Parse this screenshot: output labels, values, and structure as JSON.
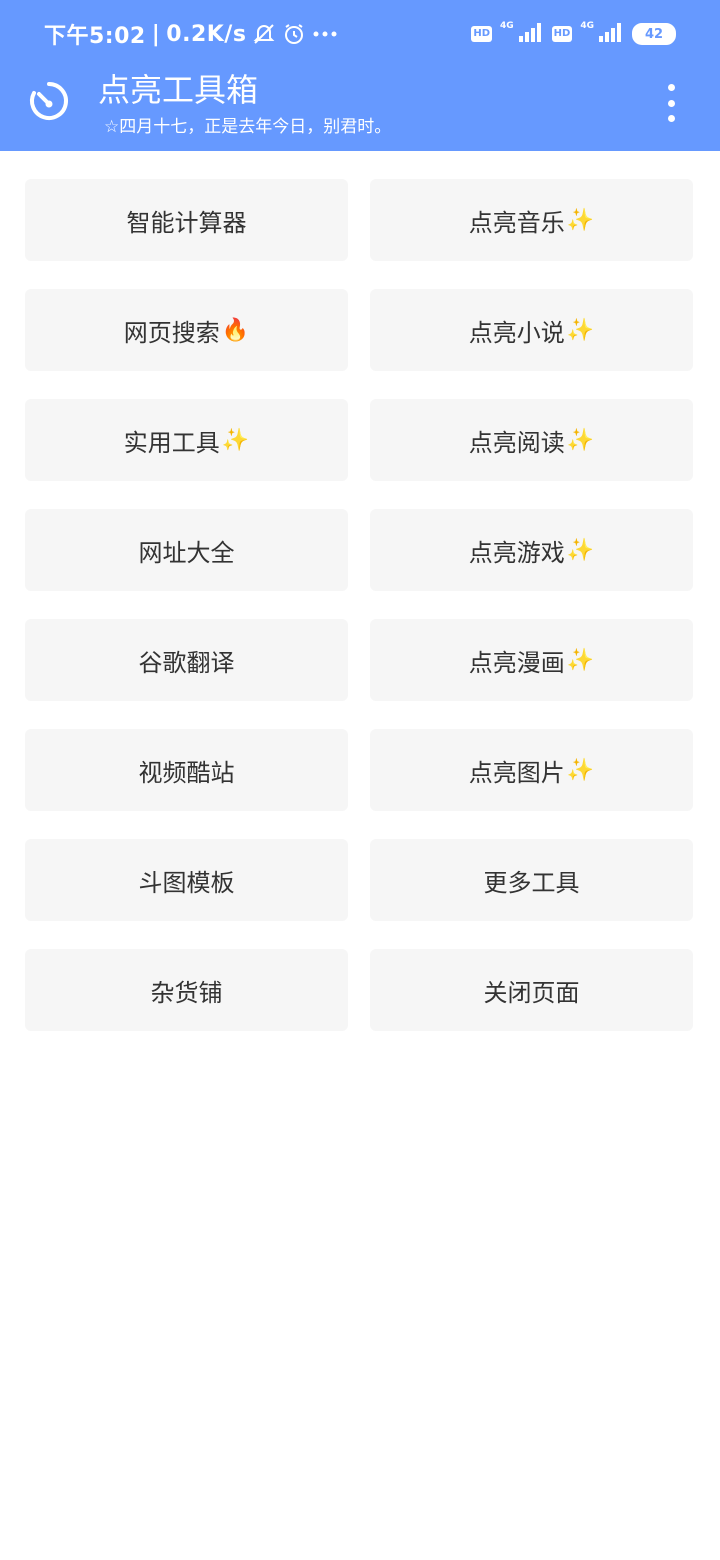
{
  "status_bar": {
    "time": "下午5:02",
    "separator": "|",
    "net_speed": "0.2K/s",
    "icons": [
      "mute-icon",
      "alarm-icon",
      "more-dots-icon"
    ],
    "sim1": {
      "hd": "HD",
      "net": "4G"
    },
    "sim2": {
      "hd": "HD",
      "net": "4G"
    },
    "battery": "42"
  },
  "app_bar": {
    "title": "点亮工具箱",
    "subtitle": "☆四月十七，正是去年今日，别君时。",
    "left_icon": "timer-icon",
    "right_icon": "more-vert-icon"
  },
  "colors": {
    "header": "#6699ff",
    "tile_bg": "#f6f6f6",
    "tile_text": "#333333"
  },
  "tiles": [
    {
      "label": "智能计算器",
      "emoji": ""
    },
    {
      "label": "点亮音乐",
      "emoji": "✨"
    },
    {
      "label": "网页搜索",
      "emoji": "🔥"
    },
    {
      "label": "点亮小说",
      "emoji": "✨"
    },
    {
      "label": "实用工具",
      "emoji": "✨"
    },
    {
      "label": "点亮阅读",
      "emoji": "✨"
    },
    {
      "label": "网址大全",
      "emoji": ""
    },
    {
      "label": "点亮游戏",
      "emoji": "✨"
    },
    {
      "label": "谷歌翻译",
      "emoji": ""
    },
    {
      "label": "点亮漫画",
      "emoji": "✨"
    },
    {
      "label": "视频酷站",
      "emoji": ""
    },
    {
      "label": "点亮图片",
      "emoji": "✨"
    },
    {
      "label": "斗图模板",
      "emoji": ""
    },
    {
      "label": "更多工具",
      "emoji": ""
    },
    {
      "label": "杂货铺",
      "emoji": ""
    },
    {
      "label": "关闭页面",
      "emoji": ""
    }
  ]
}
